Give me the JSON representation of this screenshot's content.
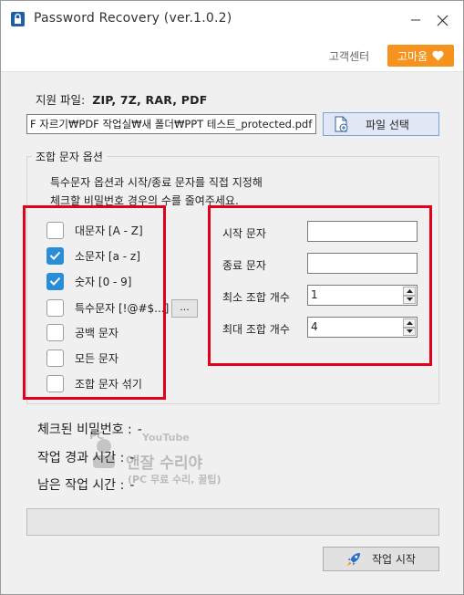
{
  "window": {
    "title": "Password Recovery (ver.1.0.2)"
  },
  "topbar": {
    "support_label": "고객센터",
    "thanks_label": "고마움"
  },
  "file": {
    "supported_label": "지원 파일:",
    "supported_types": "ZIP, 7Z, RAR, PDF",
    "path_value": "F 자르기₩PDF 작업실₩새 폴더₩PPT 테스트_protected.pdf",
    "select_button": "파일 선택"
  },
  "options": {
    "group_title": "조합 문자 옵션",
    "desc_line1": "특수문자 옵션과 시작/종료 문자를 직접 지정해",
    "desc_line2": "체크할 비밀번호 경우의 수를 줄여주세요.",
    "checkboxes": [
      {
        "label": "대문자 [A - Z]",
        "checked": false
      },
      {
        "label": "소문자 [a - z]",
        "checked": true
      },
      {
        "label": "숫자 [0 - 9]",
        "checked": true
      },
      {
        "label": "특수문자 [!@#$...]",
        "checked": false
      },
      {
        "label": "공백 문자",
        "checked": false
      },
      {
        "label": "모든 문자",
        "checked": false
      },
      {
        "label": "조합 문자 섞기",
        "checked": false
      }
    ],
    "more_button": "...",
    "fields": {
      "start_label": "시작 문자",
      "start_value": "",
      "end_label": "종료 문자",
      "end_value": "",
      "min_label": "최소 조합 개수",
      "min_value": "1",
      "max_label": "최대 조합 개수",
      "max_value": "4"
    }
  },
  "status": {
    "checked_label": "체크된 비밀번호 :",
    "checked_value": "-",
    "elapsed_label": "작업 경과 시간 :",
    "elapsed_value": "-",
    "remaining_label": "남은 작업 시간 :",
    "remaining_value": "-"
  },
  "watermark": {
    "line1": "PC",
    "line2": "YouTube",
    "line3": "앤잘 수리야",
    "line4": "(PC 무료 수리, 꿀팁)"
  },
  "progress": {
    "value": 0
  },
  "start_button": "작업 시작",
  "colors": {
    "accent": "#f5931e",
    "check": "#2a8dd8",
    "highlight": "#e2001a"
  }
}
